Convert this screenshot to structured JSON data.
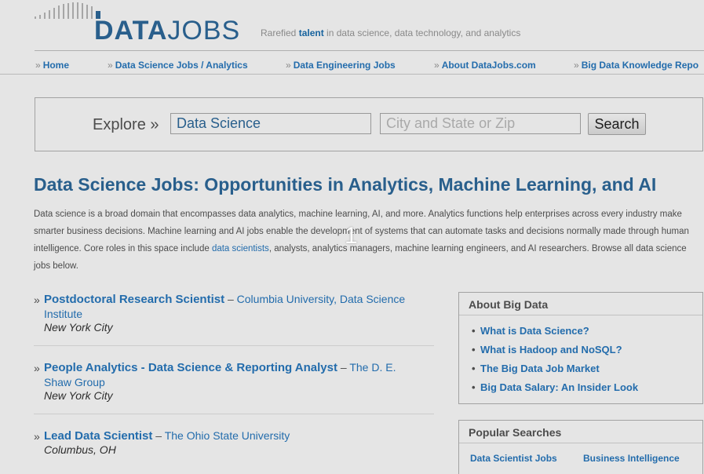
{
  "logo": {
    "word1": "DATA",
    "word2": "JOBS"
  },
  "tagline": {
    "prefix": "Rarefied ",
    "highlight": "talent",
    "suffix": " in data science, data technology, and analytics"
  },
  "nav": [
    {
      "label": "Home"
    },
    {
      "label": "Data Science Jobs / Analytics"
    },
    {
      "label": "Data Engineering Jobs"
    },
    {
      "label": "About DataJobs.com"
    },
    {
      "label": "Big Data Knowledge Repo"
    }
  ],
  "search": {
    "label": "Explore »",
    "keyword_value": "Data Science",
    "location_placeholder": "City and State or Zip",
    "button_label": "Search"
  },
  "page_title": "Data Science Jobs: Opportunities in Analytics, Machine Learning, and AI",
  "intro": {
    "text_before": "Data science is a broad domain that encompasses data analytics, machine learning, AI, and more. Analytics functions help enterprises across every industry make smarter business decisions. Machine learning and AI jobs enable the development of systems that can automate tasks and decisions normally made through human intelligence. Core roles in this space include ",
    "link": "data scientists",
    "text_after": ", analysts, analytics managers, machine learning engineers, and AI researchers. Browse all data science jobs below."
  },
  "jobs": [
    {
      "title": "Postdoctoral Research Scientist",
      "org": "Columbia University, Data Science Institute",
      "location": "New York City"
    },
    {
      "title": "People Analytics - Data Science & Reporting Analyst",
      "org": "The D. E. Shaw Group",
      "location": "New York City"
    },
    {
      "title": "Lead Data Scientist",
      "org": "The Ohio State University",
      "location": "Columbus, OH"
    }
  ],
  "job_marker": "»",
  "job_dash": "–",
  "sidebar": {
    "about": {
      "title": "About Big Data",
      "links": [
        "What is Data Science?",
        "What is Hadoop and NoSQL?",
        "The Big Data Job Market",
        "Big Data Salary: An Insider Look"
      ]
    },
    "popular": {
      "title": "Popular Searches",
      "links": [
        "Data Scientist Jobs",
        "Business Intelligence"
      ]
    }
  },
  "overlay_badge": "1",
  "colors": {
    "accent": "#2e6a9c",
    "link": "#2779c0"
  }
}
